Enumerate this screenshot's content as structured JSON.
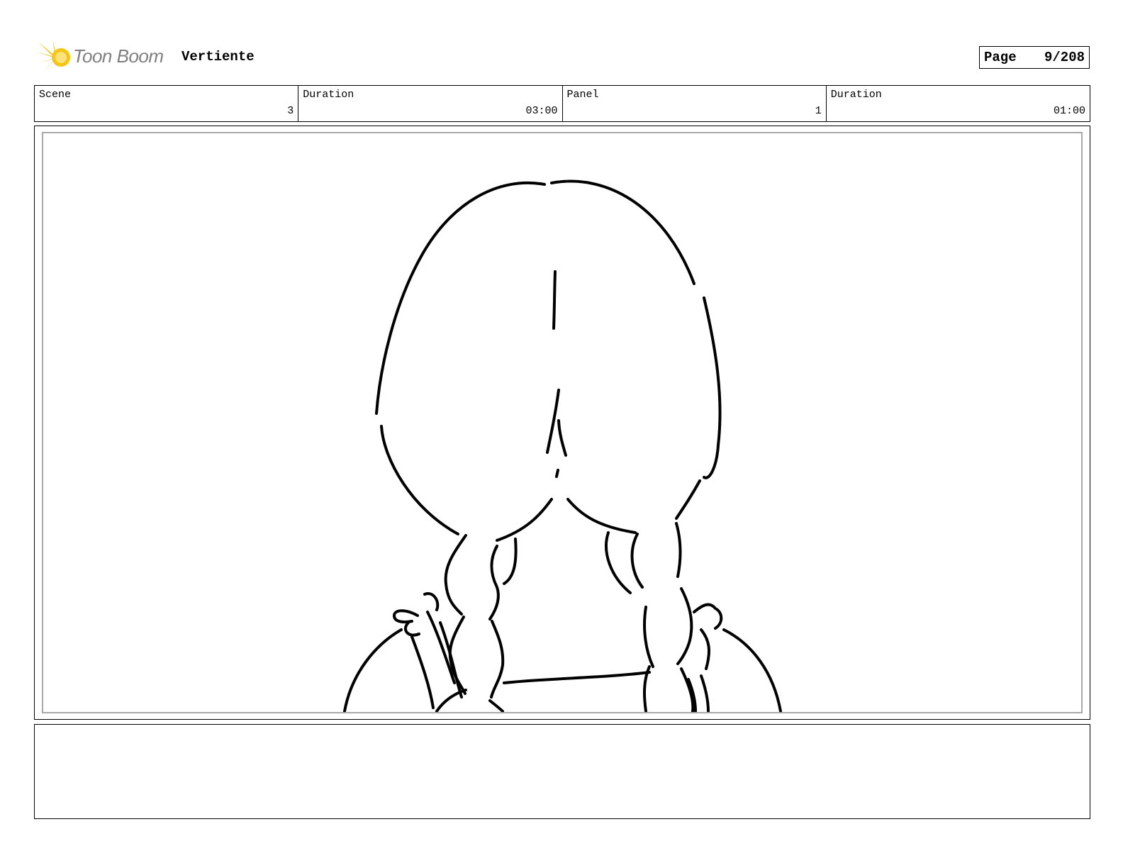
{
  "header": {
    "logo_text": "Toon Boom",
    "project_title": "Vertiente",
    "page_label": "Page",
    "page_value": "9/208"
  },
  "info": {
    "scene_label": "Scene",
    "scene_value": "3",
    "scene_duration_label": "Duration",
    "scene_duration_value": "03:00",
    "panel_label": "Panel",
    "panel_value": "1",
    "panel_duration_label": "Duration",
    "panel_duration_value": "01:00"
  },
  "notes": {
    "text": ""
  },
  "colors": {
    "logo_accent": "#f5c518",
    "logo_text": "#7f7f7f",
    "panel_inner_border": "#a9a9a9",
    "border": "#000000"
  }
}
